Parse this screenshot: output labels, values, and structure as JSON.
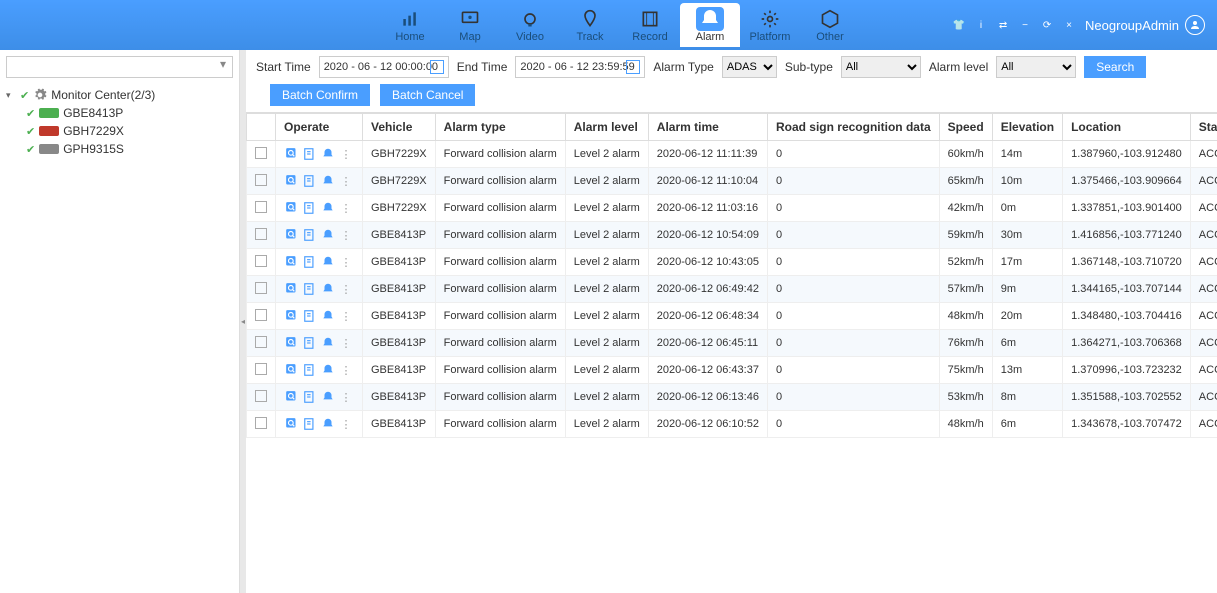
{
  "nav": {
    "items": [
      {
        "label": "Home",
        "icon": "chart"
      },
      {
        "label": "Map",
        "icon": "monitor"
      },
      {
        "label": "Video",
        "icon": "camera"
      },
      {
        "label": "Track",
        "icon": "pin"
      },
      {
        "label": "Record",
        "icon": "film"
      },
      {
        "label": "Alarm",
        "icon": "bell",
        "active": true
      },
      {
        "label": "Platform",
        "icon": "gear"
      },
      {
        "label": "Other",
        "icon": "cube"
      }
    ]
  },
  "user": {
    "name": "NeogroupAdmin"
  },
  "sidebar": {
    "root": "Monitor Center(2/3)",
    "items": [
      {
        "label": "GBE8413P",
        "color": "green"
      },
      {
        "label": "GBH7229X",
        "color": "red"
      },
      {
        "label": "GPH9315S",
        "color": "gray"
      }
    ]
  },
  "filters": {
    "start_label": "Start Time",
    "start_value": "2020 - 06 - 12 00:00:00",
    "end_label": "End Time",
    "end_value": "2020 - 06 - 12 23:59:59",
    "alarm_type_label": "Alarm Type",
    "alarm_type_value": "ADAS",
    "sub_type_label": "Sub-type",
    "sub_type_value": "All",
    "alarm_level_label": "Alarm level",
    "alarm_level_value": "All",
    "search_btn": "Search",
    "batch_confirm": "Batch Confirm",
    "batch_cancel": "Batch Cancel"
  },
  "table": {
    "headers": [
      "",
      "Operate",
      "Vehicle",
      "Alarm type",
      "Alarm level",
      "Alarm time",
      "Road sign recognition data",
      "Speed",
      "Elevation",
      "Location",
      "Status"
    ],
    "rows": [
      {
        "vehicle": "GBH7229X",
        "type": "Forward collision alarm",
        "level": "Level 2 alarm",
        "time": "2020-06-12 11:11:39",
        "road": "0",
        "speed": "60km/h",
        "elev": "14m",
        "loc": "1.387960,-103.912480",
        "status": "ACC OFF,Left turn(Close),Right turn(Close),Winds"
      },
      {
        "vehicle": "GBH7229X",
        "type": "Forward collision alarm",
        "level": "Level 2 alarm",
        "time": "2020-06-12 11:10:04",
        "road": "0",
        "speed": "65km/h",
        "elev": "10m",
        "loc": "1.375466,-103.909664",
        "status": "ACC OFF,Left turn(Close),Right turn(Close),Winds"
      },
      {
        "vehicle": "GBH7229X",
        "type": "Forward collision alarm",
        "level": "Level 2 alarm",
        "time": "2020-06-12 11:03:16",
        "road": "0",
        "speed": "42km/h",
        "elev": "0m",
        "loc": "1.337851,-103.901400",
        "status": "ACC OFF,Left turn(Close),Right turn(Close),Winds"
      },
      {
        "vehicle": "GBE8413P",
        "type": "Forward collision alarm",
        "level": "Level 2 alarm",
        "time": "2020-06-12 10:54:09",
        "road": "0",
        "speed": "59km/h",
        "elev": "30m",
        "loc": "1.416856,-103.771240",
        "status": "ACC OFF,Left turn(Close),Right turn(Close),Winds"
      },
      {
        "vehicle": "GBE8413P",
        "type": "Forward collision alarm",
        "level": "Level 2 alarm",
        "time": "2020-06-12 10:43:05",
        "road": "0",
        "speed": "52km/h",
        "elev": "17m",
        "loc": "1.367148,-103.710720",
        "status": "ACC OFF,Left turn(Close),Right turn(Close),Winds"
      },
      {
        "vehicle": "GBE8413P",
        "type": "Forward collision alarm",
        "level": "Level 2 alarm",
        "time": "2020-06-12 06:49:42",
        "road": "0",
        "speed": "57km/h",
        "elev": "9m",
        "loc": "1.344165,-103.707144",
        "status": "ACC OFF,Left turn(Close),Right turn(Close),Winds"
      },
      {
        "vehicle": "GBE8413P",
        "type": "Forward collision alarm",
        "level": "Level 2 alarm",
        "time": "2020-06-12 06:48:34",
        "road": "0",
        "speed": "48km/h",
        "elev": "20m",
        "loc": "1.348480,-103.704416",
        "status": "ACC OFF,Left turn(Close),Right turn(Close),Winds"
      },
      {
        "vehicle": "GBE8413P",
        "type": "Forward collision alarm",
        "level": "Level 2 alarm",
        "time": "2020-06-12 06:45:11",
        "road": "0",
        "speed": "76km/h",
        "elev": "6m",
        "loc": "1.364271,-103.706368",
        "status": "ACC OFF,Left turn(Close),Right turn(Close),Winds"
      },
      {
        "vehicle": "GBE8413P",
        "type": "Forward collision alarm",
        "level": "Level 2 alarm",
        "time": "2020-06-12 06:43:37",
        "road": "0",
        "speed": "75km/h",
        "elev": "13m",
        "loc": "1.370996,-103.723232",
        "status": "ACC OFF,Left turn(Close),Right turn(Close),Winds"
      },
      {
        "vehicle": "GBE8413P",
        "type": "Forward collision alarm",
        "level": "Level 2 alarm",
        "time": "2020-06-12 06:13:46",
        "road": "0",
        "speed": "53km/h",
        "elev": "8m",
        "loc": "1.351588,-103.702552",
        "status": "ACC OFF,Left turn(Close),Right turn(Close),Winds"
      },
      {
        "vehicle": "GBE8413P",
        "type": "Forward collision alarm",
        "level": "Level 2 alarm",
        "time": "2020-06-12 06:10:52",
        "road": "0",
        "speed": "48km/h",
        "elev": "6m",
        "loc": "1.343678,-103.707472",
        "status": "ACC OFF,Left turn(Close),Right turn(Close),Winds"
      }
    ]
  }
}
